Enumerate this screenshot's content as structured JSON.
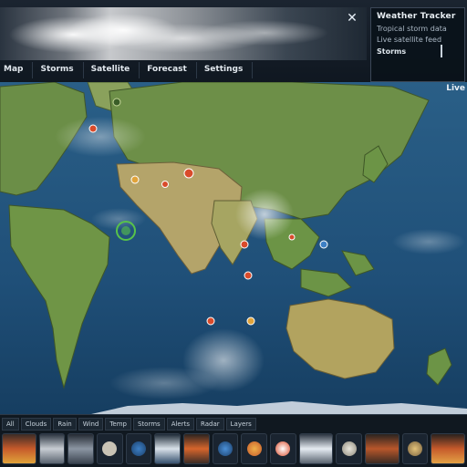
{
  "banner": {
    "info_title": "Weather Tracker",
    "info_line1": "Tropical storm data",
    "info_line2": "Live satellite feed",
    "info_line3": "Storms"
  },
  "menu": [
    {
      "label": "Map"
    },
    {
      "label": "Storms"
    },
    {
      "label": "Satellite"
    },
    {
      "label": "Forecast"
    },
    {
      "label": "Settings"
    }
  ],
  "map": {
    "corner_label": "Live"
  },
  "bottom": {
    "tabs": [
      {
        "label": "All"
      },
      {
        "label": "Clouds"
      },
      {
        "label": "Rain"
      },
      {
        "label": "Wind"
      },
      {
        "label": "Temp"
      },
      {
        "label": "Storms"
      },
      {
        "label": "Alerts"
      },
      {
        "label": "Radar"
      },
      {
        "label": "Layers"
      }
    ]
  },
  "colors": {
    "ocean": "#1f4f78",
    "land": "#6f8f4b",
    "desert": "#b8a565",
    "storm_marker": "#d94b2b",
    "panel_bg": "#101820"
  }
}
